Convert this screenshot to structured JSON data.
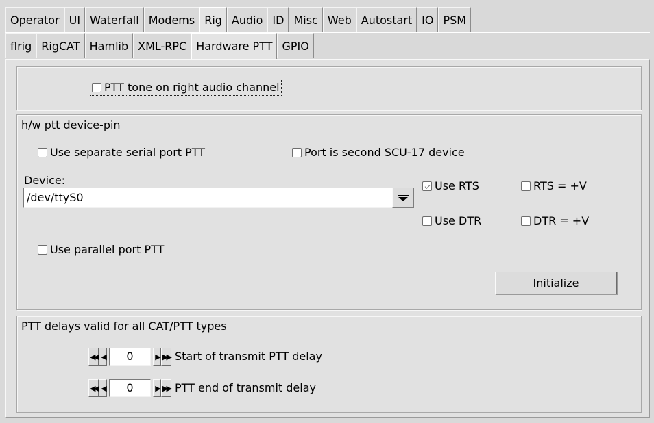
{
  "tabs": {
    "row1": [
      "Operator",
      "UI",
      "Waterfall",
      "Modems",
      "Rig",
      "Audio",
      "ID",
      "Misc",
      "Web",
      "Autostart",
      "IO",
      "PSM"
    ],
    "row1_active": "Rig",
    "row2": [
      "flrig",
      "RigCAT",
      "Hamlib",
      "XML-RPC",
      "Hardware PTT",
      "GPIO"
    ],
    "row2_active": "Hardware PTT"
  },
  "tone_group": {
    "right_channel_label": "PTT tone on right audio channel",
    "right_channel_checked": false
  },
  "device_group": {
    "title": "h/w ptt device-pin",
    "separate_serial_label": "Use separate serial port PTT",
    "separate_serial_checked": false,
    "scu17_label": "Port is second SCU-17 device",
    "scu17_checked": false,
    "device_label": "Device:",
    "device_value": "/dev/ttyS0",
    "use_rts_label": "Use RTS",
    "use_rts_checked": false,
    "rts_v_label": "RTS = +V",
    "rts_v_checked": false,
    "use_dtr_label": "Use DTR",
    "use_dtr_checked": false,
    "dtr_v_label": "DTR = +V",
    "dtr_v_checked": false,
    "parallel_label": "Use parallel port PTT",
    "parallel_checked": false,
    "initialize_label": "Initialize"
  },
  "delay_group": {
    "title": "PTT delays valid for all CAT/PTT types",
    "start_delay_value": "0",
    "start_delay_label": "Start of transmit PTT delay",
    "end_delay_value": "0",
    "end_delay_label": "PTT end of transmit delay"
  },
  "icons": {
    "fast_back": "double-left-arrow",
    "back": "left-arrow",
    "forward": "right-arrow",
    "fast_forward": "double-right-arrow",
    "dropdown": "down-triangle"
  }
}
